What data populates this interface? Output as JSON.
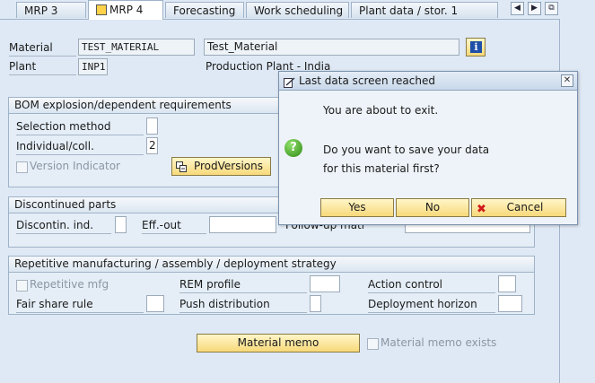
{
  "tabs": [
    {
      "label": "MRP 3",
      "active": false
    },
    {
      "label": "MRP 4",
      "active": true
    },
    {
      "label": "Forecasting",
      "active": false
    },
    {
      "label": "Work scheduling",
      "active": false
    },
    {
      "label": "Plant data / stor. 1",
      "active": false
    }
  ],
  "tab_nav": {
    "prev": "◀",
    "next": "▶",
    "list": "⧉"
  },
  "header": {
    "material_label": "Material",
    "material_value": "TEST_MATERIAL",
    "material_desc": "Test_Material",
    "plant_label": "Plant",
    "plant_value": "INP1",
    "plant_desc": "Production Plant - India",
    "info_icon": "i"
  },
  "bom": {
    "title": "BOM explosion/dependent requirements",
    "selection_method_label": "Selection method",
    "selection_method_value": "",
    "individual_coll_label": "Individual/coll.",
    "individual_coll_value": "2",
    "version_indicator_label": "Version Indicator",
    "prodversions_label": "ProdVersions"
  },
  "discontinued": {
    "title": "Discontinued parts",
    "discontin_label": "Discontin. ind.",
    "eff_out_label": "Eff.-out",
    "follow_up_label": "Follow-up matl"
  },
  "repetitive": {
    "title": "Repetitive manufacturing / assembly / deployment strategy",
    "repetitive_mfg_label": "Repetitive mfg",
    "rem_profile_label": "REM profile",
    "action_control_label": "Action control",
    "fair_share_label": "Fair share rule",
    "push_distribution_label": "Push distribution",
    "deployment_horizon_label": "Deployment horizon"
  },
  "memo": {
    "button_label": "Material memo",
    "exists_label": "Material memo exists"
  },
  "dialog": {
    "title": "Last data screen reached",
    "line1": "You are about to exit.",
    "line2": "Do you want to save your data",
    "line3": "for this material first?",
    "yes_label": "Yes",
    "no_label": "No",
    "cancel_label": "Cancel",
    "close_icon": "✕",
    "question_icon": "?"
  },
  "colors": {
    "accent_button": "#f7d97a",
    "panel_bg": "#dfe9f5",
    "info_blue": "#1f4fa8",
    "question_green": "#2f8a14",
    "cancel_red": "#d11a1a"
  }
}
